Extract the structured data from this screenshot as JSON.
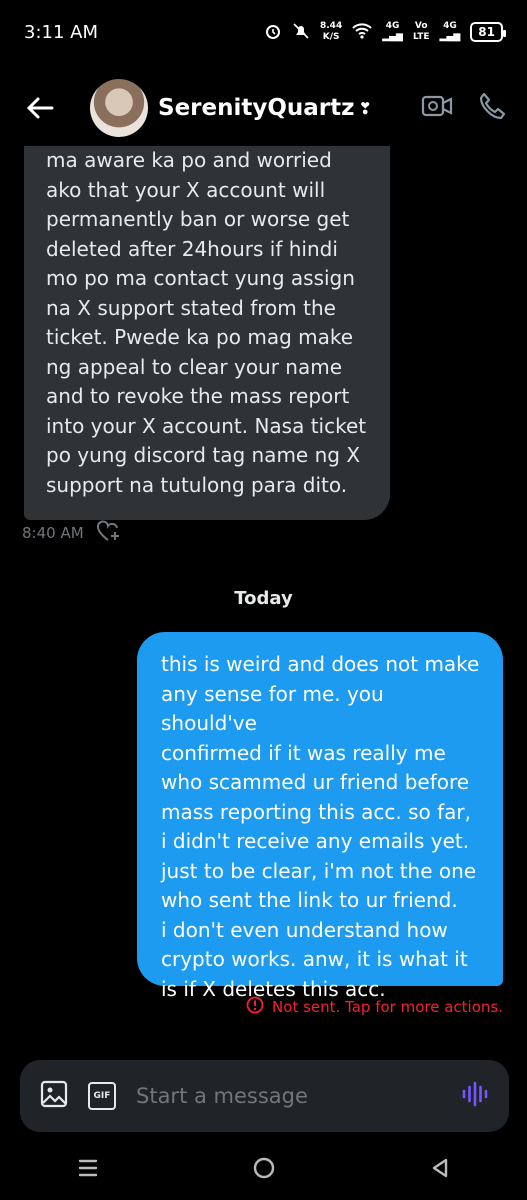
{
  "status": {
    "time": "3:11 AM",
    "net_speed": "8.44",
    "net_unit": "K/S",
    "signal1": "4G",
    "volte_top": "Vo",
    "volte_bottom": "LTE",
    "signal2": "4G",
    "battery": "81"
  },
  "header": {
    "name": "SerenityQuartz",
    "verified_symbol": "❣",
    "icons": [
      "back-arrow-icon",
      "video-icon",
      "phone-icon"
    ]
  },
  "messages": {
    "incoming": {
      "text": "ma aware ka po and worried\nako that your X account will\npermanently ban or worse get\ndeleted after 24hours if hindi\nmo po ma contact yung assign\nna X support stated from the\nticket. Pwede ka po mag make\nng appeal to clear your name\nand to revoke the mass report\ninto your X account. Nasa ticket\npo yung discord tag name ng X\nsupport na tutulong para dito.",
      "time": "8:40 AM"
    },
    "day_separator": "Today",
    "outgoing": {
      "text": "this is weird and does not make\nany sense for me. you should've\nconfirmed if it was really me\nwho scammed ur friend before\nmass reporting this acc. so far,\ni didn't receive any emails yet.\njust to be clear, i'm not the one\nwho sent the link to ur friend.\ni don't even understand how\ncrypto works. anw, it is what it\nis if X deletes this acc.",
      "status": "Not sent. Tap for more actions."
    }
  },
  "composer": {
    "placeholder": "Start a message",
    "gif_label": "GIF"
  },
  "colors": {
    "accent": "#1d9bf0",
    "error": "#f4212e",
    "voice": "#7856ff"
  }
}
